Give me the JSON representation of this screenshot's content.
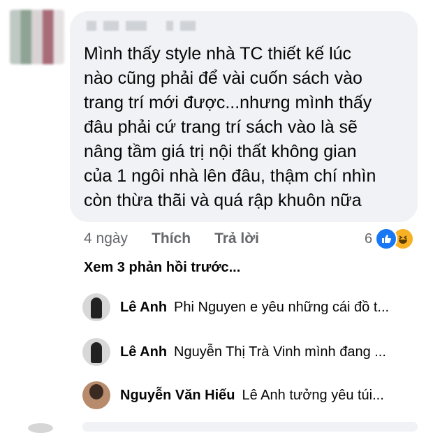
{
  "comment": {
    "lines": [
      "Mình thấy style nhà TC thiết kế lúc",
      "nào cũng phải để vài cuốn sách vào",
      "trang trí mới được...nhưng mình thấy",
      "đâu phải cứ trang trí sách vào là sẽ",
      "nâng tầm giá trị nội thất không gian",
      "của 1 ngôi nhà lên đâu, thậm chí nhìn",
      "còn thừa thãi và quá rập khuôn nữa"
    ],
    "time": "4 ngày",
    "like_label": "Thích",
    "reply_label": "Trả lời",
    "reaction_count": "6"
  },
  "view_previous": "Xem 3 phản hồi trước...",
  "replies": [
    {
      "name": "Lê Anh",
      "text": "Phi Nguyen  e yêu những cái đồ t..."
    },
    {
      "name": "Lê Anh",
      "text": "Nguyễn Thị Trà Vinh mình đang ..."
    },
    {
      "name": "Nguyễn Văn Hiếu",
      "text": "Lê Anh tưởng yêu túi..."
    }
  ],
  "colors": {
    "bubble": "#f0f2f5",
    "meta": "#65676b",
    "like_blue": "#1877f2",
    "haha_yellow": "#f7b125"
  },
  "icons": [
    "like-reaction-icon",
    "haha-reaction-icon"
  ]
}
